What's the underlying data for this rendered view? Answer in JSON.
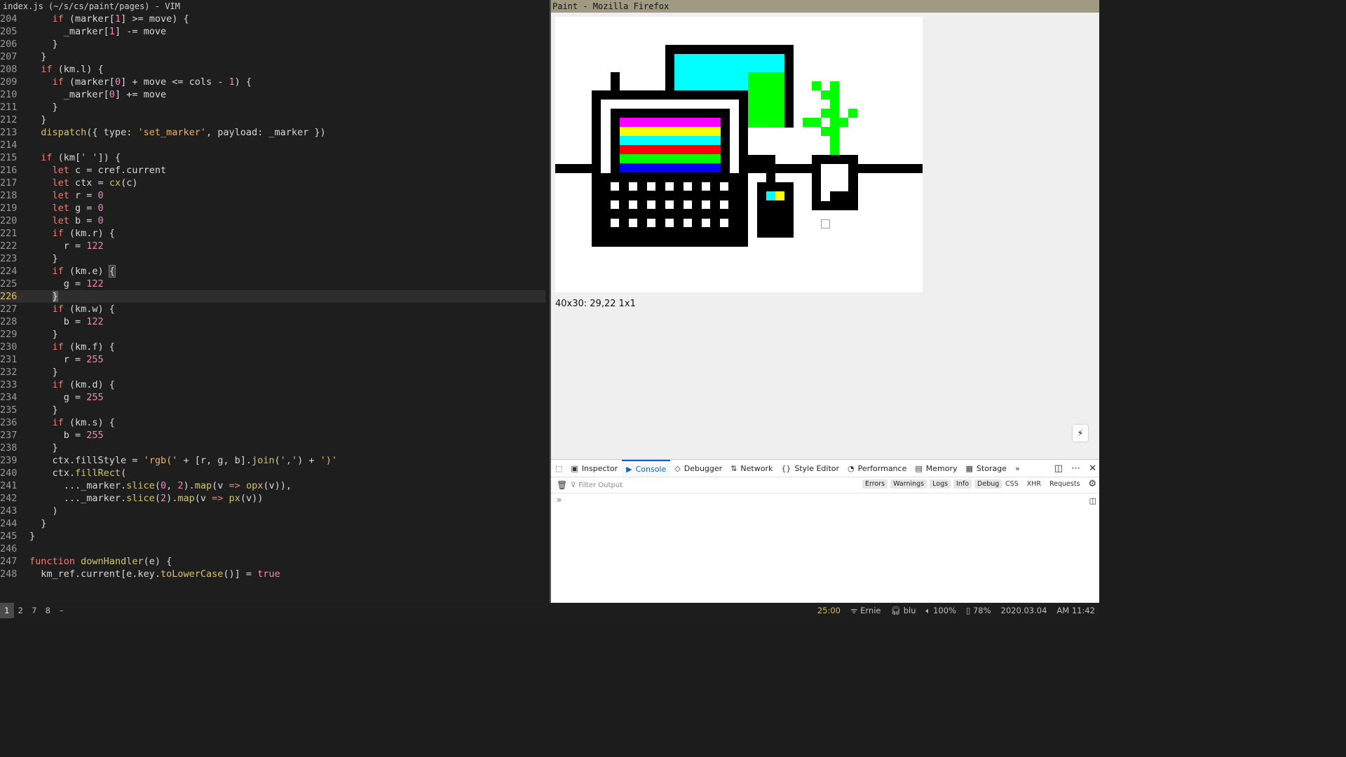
{
  "vim": {
    "title": "index.js (~/s/cs/paint/pages) - VIM"
  },
  "firefox": {
    "title": "Paint - Mozilla Firefox",
    "status": "40x30: 29,22 1x1"
  },
  "devtools": {
    "tabs": [
      "Inspector",
      "Console",
      "Debugger",
      "Network",
      "Style Editor",
      "Performance",
      "Memory",
      "Storage"
    ],
    "active_tab": "Console",
    "filter_placeholder": "Filter Output",
    "levels": [
      "Errors",
      "Warnings",
      "Logs",
      "Info",
      "Debug"
    ],
    "types": [
      "CSS",
      "XHR",
      "Requests"
    ]
  },
  "taskbar": {
    "workspaces": [
      "1",
      "2",
      "7",
      "8",
      "–"
    ],
    "time_left": "25:00",
    "wifi": "Ernie",
    "headphones": "blu",
    "volume": "100%",
    "battery": "78%",
    "date": "2020.03.04",
    "clock": "AM 11:42"
  },
  "code": [
    {
      "n": "204",
      "html": "    <span class='kw'>if</span> (marker[<span class='num'>1</span>] >= move) {"
    },
    {
      "n": "205",
      "html": "      _marker[<span class='num'>1</span>] -= move"
    },
    {
      "n": "206",
      "html": "    }"
    },
    {
      "n": "207",
      "html": "  }"
    },
    {
      "n": "208",
      "html": "  <span class='kw'>if</span> (km.l) {"
    },
    {
      "n": "209",
      "html": "    <span class='kw'>if</span> (marker[<span class='num'>0</span>] + move <= cols - <span class='num'>1</span>) {"
    },
    {
      "n": "210",
      "html": "      _marker[<span class='num'>0</span>] += move"
    },
    {
      "n": "211",
      "html": "    }"
    },
    {
      "n": "212",
      "html": "  }"
    },
    {
      "n": "213",
      "html": "  <span class='fn'>dispatch</span>({ type: <span class='str'>'set_marker'</span>, payload: _marker })"
    },
    {
      "n": "214",
      "html": ""
    },
    {
      "n": "215",
      "html": "  <span class='kw'>if</span> (km[<span class='str'>' '</span>]) {"
    },
    {
      "n": "216",
      "html": "    <span class='kw'>let</span> c = cref.current"
    },
    {
      "n": "217",
      "html": "    <span class='kw'>let</span> ctx = <span class='fn'>cx</span>(c)"
    },
    {
      "n": "218",
      "html": "    <span class='kw'>let</span> r = <span class='num'>0</span>"
    },
    {
      "n": "219",
      "html": "    <span class='kw'>let</span> g = <span class='num'>0</span>"
    },
    {
      "n": "220",
      "html": "    <span class='kw'>let</span> b = <span class='num'>0</span>"
    },
    {
      "n": "221",
      "html": "    <span class='kw'>if</span> (km.r) {"
    },
    {
      "n": "222",
      "html": "      r = <span class='num'>122</span>"
    },
    {
      "n": "223",
      "html": "    }"
    },
    {
      "n": "224",
      "html": "    <span class='kw'>if</span> (km.e) <span class='match'>{</span>"
    },
    {
      "n": "225",
      "html": "      g = <span class='num'>122</span>"
    },
    {
      "n": "226",
      "html": "    <span class='cursor'>}</span>",
      "cur": true
    },
    {
      "n": "227",
      "html": "    <span class='kw'>if</span> (km.w) {"
    },
    {
      "n": "228",
      "html": "      b = <span class='num'>122</span>"
    },
    {
      "n": "229",
      "html": "    }"
    },
    {
      "n": "230",
      "html": "    <span class='kw'>if</span> (km.f) {"
    },
    {
      "n": "231",
      "html": "      r = <span class='num'>255</span>"
    },
    {
      "n": "232",
      "html": "    }"
    },
    {
      "n": "233",
      "html": "    <span class='kw'>if</span> (km.d) {"
    },
    {
      "n": "234",
      "html": "      g = <span class='num'>255</span>"
    },
    {
      "n": "235",
      "html": "    }"
    },
    {
      "n": "236",
      "html": "    <span class='kw'>if</span> (km.s) {"
    },
    {
      "n": "237",
      "html": "      b = <span class='num'>255</span>"
    },
    {
      "n": "238",
      "html": "    }"
    },
    {
      "n": "239",
      "html": "    ctx.fillStyle = <span class='str'>'rgb('</span> + [r, g, b].<span class='fn'>join</span>(<span class='str'>','</span>) + <span class='str'>')'</span>"
    },
    {
      "n": "240",
      "html": "    ctx.<span class='fn'>fillRect</span>("
    },
    {
      "n": "241",
      "html": "      ..._marker.<span class='fn'>slice</span>(<span class='num'>0</span>, <span class='num'>2</span>).<span class='fn'>map</span>(v <span class='kw'>=></span> <span class='fn'>opx</span>(v)),"
    },
    {
      "n": "242",
      "html": "      ..._marker.<span class='fn'>slice</span>(<span class='num'>2</span>).<span class='fn'>map</span>(v <span class='kw'>=></span> <span class='fn'>px</span>(v))"
    },
    {
      "n": "243",
      "html": "    )"
    },
    {
      "n": "244",
      "html": "  }"
    },
    {
      "n": "245",
      "html": "}"
    },
    {
      "n": "246",
      "html": ""
    },
    {
      "n": "247",
      "html": "<span class='kw'>function</span> <span class='fn'>downHandler</span>(e) {"
    },
    {
      "n": "248",
      "html": "  km_ref.current[e.key.<span class='fn'>toLowerCase</span>()] = <span class='num'>true</span>"
    }
  ]
}
